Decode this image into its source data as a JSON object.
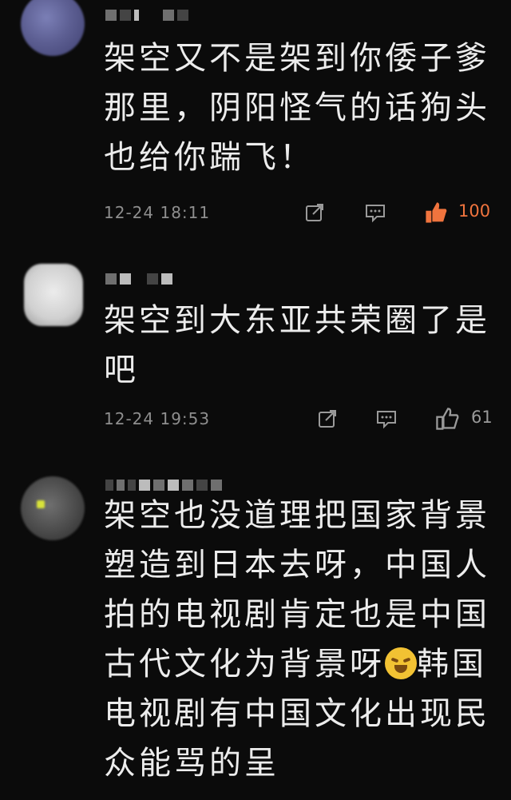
{
  "comments": [
    {
      "text": "架空又不是架到你倭子爹那里，阴阳怪气的话狗头也给你踹飞！",
      "time": "12-24 18:11",
      "likes": "100",
      "like_state": "liked"
    },
    {
      "text": "架空到大东亚共荣圈了是吧",
      "time": "12-24 19:53",
      "likes": "61",
      "like_state": "default"
    },
    {
      "text_before_emoji": "架空也没道理把国家背景塑造到日本去呀，中国人拍的电视剧肯定也是中国古代文化为背景呀",
      "emoji": "crying-laughing-emoji",
      "text_after_emoji": "韩国电视剧有中国文化出现民众能骂的呈"
    }
  ],
  "colors": {
    "background": "#0b0b0b",
    "text": "#ececec",
    "meta": "#8e8e8e",
    "liked": "#f0743e"
  }
}
